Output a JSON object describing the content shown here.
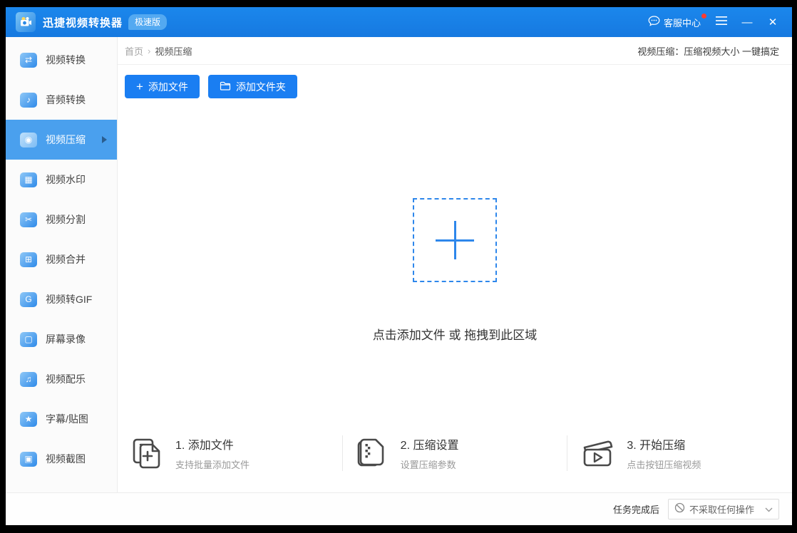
{
  "titlebar": {
    "app_title": "迅捷视频转换器",
    "badge": "极速版",
    "support_label": "客服中心",
    "minimize_glyph": "—",
    "close_glyph": "✕"
  },
  "sidebar": {
    "items": [
      {
        "label": "视频转换",
        "glyph": "⇄"
      },
      {
        "label": "音频转换",
        "glyph": "♪"
      },
      {
        "label": "视频压缩",
        "glyph": "◉",
        "active": true
      },
      {
        "label": "视频水印",
        "glyph": "▦"
      },
      {
        "label": "视频分割",
        "glyph": "✂"
      },
      {
        "label": "视频合并",
        "glyph": "⊞"
      },
      {
        "label": "视频转GIF",
        "glyph": "G"
      },
      {
        "label": "屏幕录像",
        "glyph": "▢"
      },
      {
        "label": "视频配乐",
        "glyph": "♫"
      },
      {
        "label": "字幕/贴图",
        "glyph": "★"
      },
      {
        "label": "视频截图",
        "glyph": "▣"
      }
    ]
  },
  "breadcrumb": {
    "home": "首页",
    "separator": "›",
    "current": "视频压缩",
    "tagline": "视频压缩：压缩视频大小 一键搞定"
  },
  "toolbar": {
    "add_file_label": "添加文件",
    "add_file_plus": "+",
    "add_folder_label": "添加文件夹"
  },
  "dropzone": {
    "hint": "点击添加文件 或 拖拽到此区域"
  },
  "steps": [
    {
      "title": "1. 添加文件",
      "subtitle": "支持批量添加文件"
    },
    {
      "title": "2. 压缩设置",
      "subtitle": "设置压缩参数"
    },
    {
      "title": "3. 开始压缩",
      "subtitle": "点击按钮压缩视频"
    }
  ],
  "statusbar": {
    "label": "任务完成后",
    "selected_option": "不采取任何操作"
  },
  "colors": {
    "titlebar_blue": "#1780e6",
    "accent_blue": "#1a7ef2",
    "active_item_blue": "#4aa0ee",
    "dropzone_blue": "#2e87eb",
    "badge_blue": "#53a9f1",
    "notification_red": "#ff3b30"
  }
}
